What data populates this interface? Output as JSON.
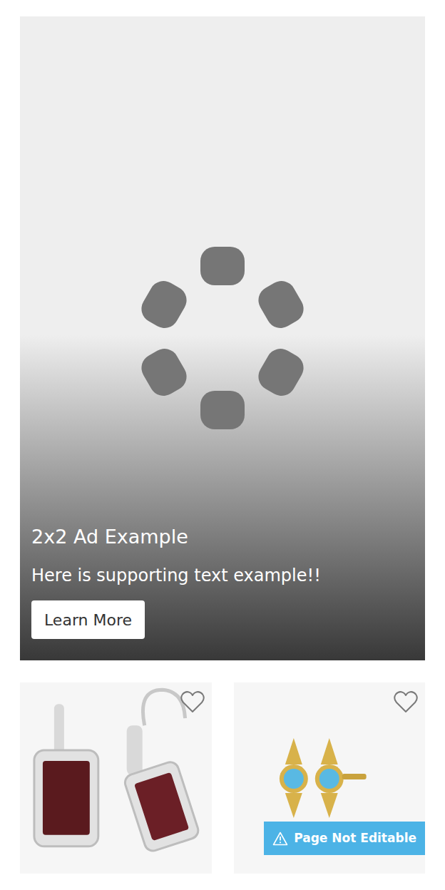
{
  "ad": {
    "title": "2x2 Ad Example",
    "text": "Here is supporting text example!!",
    "button": "Learn More"
  },
  "products": [
    {
      "kind": "garnet",
      "favorited": false
    },
    {
      "kind": "topaz",
      "favorited": false
    }
  ],
  "notice": {
    "label": "Page Not Editable"
  }
}
